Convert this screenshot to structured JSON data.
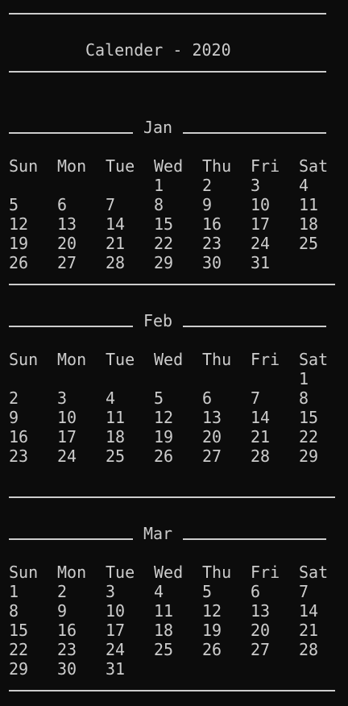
{
  "title": "Calender - 2020",
  "weekdays": [
    "Sun",
    "Mon",
    "Tue",
    "Wed",
    "Thu",
    "Fri",
    "Sat"
  ],
  "months": [
    {
      "name": "Jan",
      "weeks": [
        [
          "",
          "",
          "",
          "1",
          "2",
          "3",
          "4"
        ],
        [
          "5",
          "6",
          "7",
          "8",
          "9",
          "10",
          "11"
        ],
        [
          "12",
          "13",
          "14",
          "15",
          "16",
          "17",
          "18"
        ],
        [
          "19",
          "20",
          "21",
          "22",
          "23",
          "24",
          "25"
        ],
        [
          "26",
          "27",
          "28",
          "29",
          "30",
          "31",
          ""
        ]
      ]
    },
    {
      "name": "Feb",
      "weeks": [
        [
          "",
          "",
          "",
          "",
          "",
          "",
          "1"
        ],
        [
          "2",
          "3",
          "4",
          "5",
          "6",
          "7",
          "8"
        ],
        [
          "9",
          "10",
          "11",
          "12",
          "13",
          "14",
          "15"
        ],
        [
          "16",
          "17",
          "18",
          "19",
          "20",
          "21",
          "22"
        ],
        [
          "23",
          "24",
          "25",
          "26",
          "27",
          "28",
          "29"
        ]
      ]
    },
    {
      "name": "Mar",
      "weeks": [
        [
          "1",
          "2",
          "3",
          "4",
          "5",
          "6",
          "7"
        ],
        [
          "8",
          "9",
          "10",
          "11",
          "12",
          "13",
          "14"
        ],
        [
          "15",
          "16",
          "17",
          "18",
          "19",
          "20",
          "21"
        ],
        [
          "22",
          "23",
          "24",
          "25",
          "26",
          "27",
          "28"
        ],
        [
          "29",
          "30",
          "31",
          "",
          "",
          "",
          ""
        ]
      ]
    }
  ]
}
